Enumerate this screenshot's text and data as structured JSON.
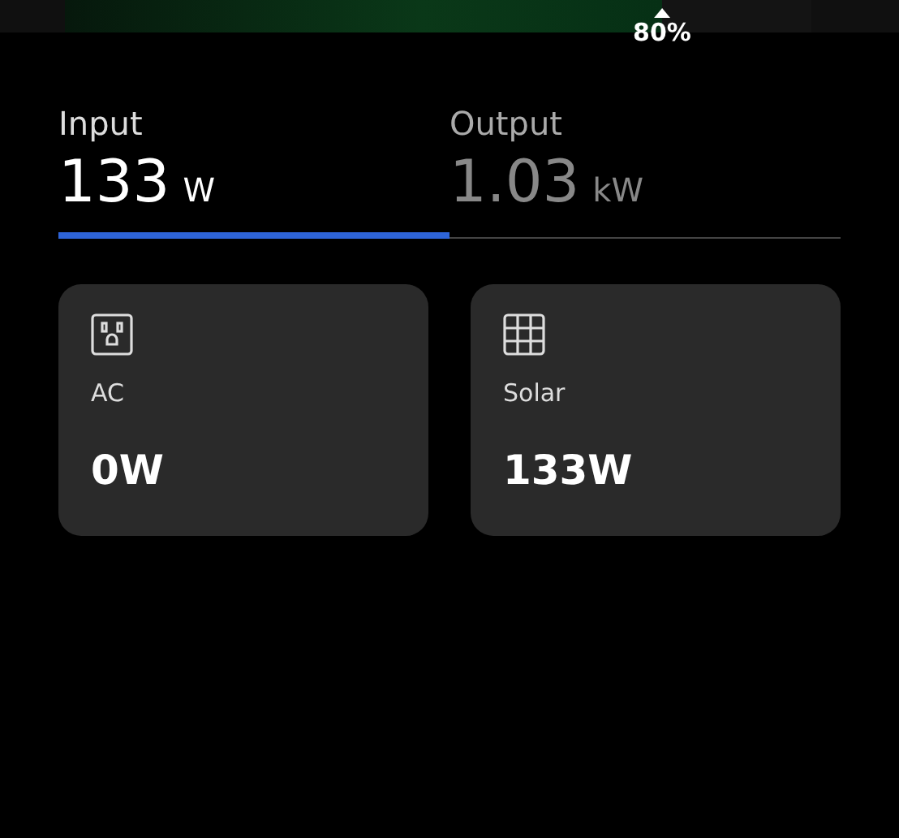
{
  "battery": {
    "level": 0.8,
    "reading": "80%"
  },
  "tabs": [
    {
      "label": "Input",
      "value": "133",
      "unit": "W",
      "selected": true
    },
    {
      "label": "Output",
      "value": "1.03",
      "unit": "kW",
      "selected": false
    }
  ],
  "sources": [
    {
      "kind": "ac",
      "label": "AC",
      "value": "0W"
    },
    {
      "kind": "solar",
      "label": "Solar",
      "value": "133W"
    }
  ]
}
